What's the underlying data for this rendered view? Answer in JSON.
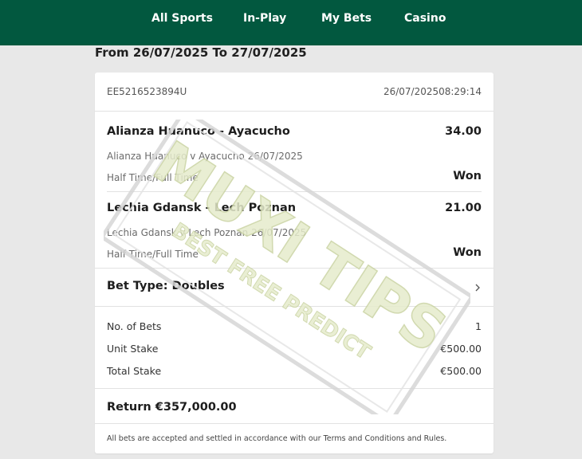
{
  "nav": {
    "items": [
      "All Sports",
      "In-Play",
      "My Bets",
      "Casino"
    ]
  },
  "header": {
    "date_range": "From 26/07/2025 To 27/07/2025"
  },
  "bet": {
    "reference": "EE5216523894U",
    "timestamp": "26/07/202508:29:14",
    "selections": [
      {
        "event": "Alianza Huanuco - Ayacucho",
        "odds": "34.00",
        "detail": "Alianza Huanuco v Ayacucho 26/07/2025",
        "market": "Half Time/Full Time",
        "result": "Won"
      },
      {
        "event": "Lechia Gdansk - Lech Poznan",
        "odds": "21.00",
        "detail": "Lechia Gdansk v Lech Poznan 26/07/2025",
        "market": "Half Time/Full Time",
        "result": "Won"
      }
    ],
    "bet_type": "Bet Type: Doubles",
    "summary": {
      "no_of_bets_label": "No. of Bets",
      "no_of_bets": "1",
      "unit_stake_label": "Unit Stake",
      "unit_stake": "€500.00",
      "total_stake_label": "Total Stake",
      "total_stake": "€500.00"
    },
    "return": "Return €357,000.00",
    "footnote": "All bets are accepted and settled in accordance with our Terms and Conditions and Rules."
  },
  "watermark": {
    "title": "MUXI TIPS",
    "subtitle": "BEST FREE PREDICT"
  },
  "colors": {
    "brand_green": "#02583f",
    "background": "#e8e8e8",
    "watermark": "#dfe7c4"
  }
}
